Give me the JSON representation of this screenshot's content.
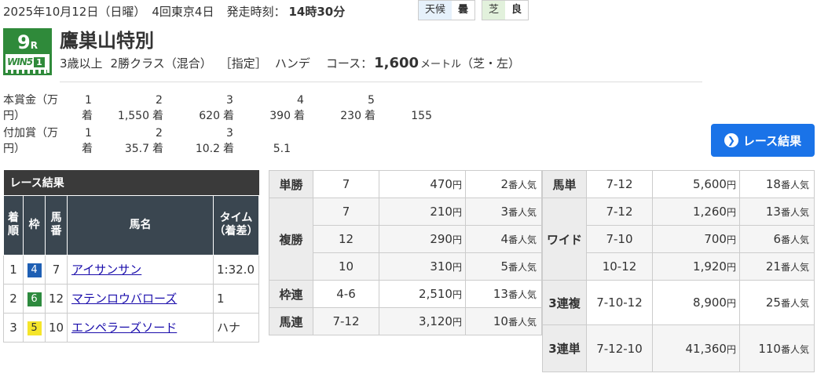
{
  "header": {
    "date": "2025年10月12日（日曜）",
    "meeting": "4回東京4日",
    "start_label": "発走時刻：",
    "start_time": "14時30分",
    "weather_label": "天候",
    "weather_value": "曇",
    "turf_label": "芝",
    "turf_value": "良"
  },
  "race": {
    "number": "9",
    "number_suffix": "R",
    "win5_text": "WIN5",
    "win5_leg": "1",
    "name": "鷹巣山特別",
    "age": "3歳以上",
    "class": "2勝クラス（混合）",
    "designation": "［指定］",
    "weight_rule": "ハンデ",
    "course_label": "コース：",
    "distance": "1,600",
    "distance_unit": "メートル",
    "surface": "（芝・左）"
  },
  "prize": {
    "main_label": "本賞金（万円）",
    "main": [
      {
        "place": "1",
        "suffix": "着",
        "amount": "1,550"
      },
      {
        "place": "2",
        "suffix": "着",
        "amount": "620"
      },
      {
        "place": "3",
        "suffix": "着",
        "amount": "390"
      },
      {
        "place": "4",
        "suffix": "着",
        "amount": "230"
      },
      {
        "place": "5",
        "suffix": "着",
        "amount": "155"
      }
    ],
    "extra_label": "付加賞（万円）",
    "extra": [
      {
        "place": "1",
        "suffix": "着",
        "amount": "35.7"
      },
      {
        "place": "2",
        "suffix": "着",
        "amount": "10.2"
      },
      {
        "place": "3",
        "suffix": "着",
        "amount": "5.1"
      }
    ]
  },
  "result_button": {
    "label": "レース結果"
  },
  "results": {
    "title": "レース結果",
    "headers": {
      "place": "着順",
      "waku": "枠",
      "num": "馬番",
      "name": "馬名",
      "time": "タイム（着差）"
    },
    "rows": [
      {
        "place": "1",
        "waku": "4",
        "waku_bg": "#1e5fb4",
        "waku_fg": "#ffffff",
        "num": "7",
        "name": "アイサンサン",
        "time": "1:32.0"
      },
      {
        "place": "2",
        "waku": "6",
        "waku_bg": "#2d8a3e",
        "waku_fg": "#ffffff",
        "num": "12",
        "name": "マテンロウバローズ",
        "time": "1"
      },
      {
        "place": "3",
        "waku": "5",
        "waku_bg": "#f5e52a",
        "waku_fg": "#333333",
        "num": "10",
        "name": "エンペラーズソード",
        "time": "ハナ"
      }
    ]
  },
  "payouts_left": {
    "yen": "円",
    "pop_suffix": "番人気",
    "tansho": {
      "label": "単勝",
      "rows": [
        {
          "combo": "7",
          "amount": "470",
          "pop": "2"
        }
      ]
    },
    "fukusho": {
      "label": "複勝",
      "rows": [
        {
          "combo": "7",
          "amount": "210",
          "pop": "3"
        },
        {
          "combo": "12",
          "amount": "290",
          "pop": "4"
        },
        {
          "combo": "10",
          "amount": "310",
          "pop": "5"
        }
      ]
    },
    "wakuren": {
      "label": "枠連",
      "rows": [
        {
          "combo": "4-6",
          "amount": "2,510",
          "pop": "13"
        }
      ]
    },
    "umaren": {
      "label": "馬連",
      "rows": [
        {
          "combo": "7-12",
          "amount": "3,120",
          "pop": "10"
        }
      ]
    }
  },
  "payouts_right": {
    "umatan": {
      "label": "馬単",
      "rows": [
        {
          "combo": "7-12",
          "amount": "5,600",
          "pop": "18"
        }
      ]
    },
    "wide": {
      "label": "ワイド",
      "rows": [
        {
          "combo": "7-12",
          "amount": "1,260",
          "pop": "13"
        },
        {
          "combo": "7-10",
          "amount": "700",
          "pop": "6"
        },
        {
          "combo": "10-12",
          "amount": "1,920",
          "pop": "21"
        }
      ]
    },
    "trio": {
      "label": "3連複",
      "rows": [
        {
          "combo": "7-10-12",
          "amount": "8,900",
          "pop": "25"
        }
      ]
    },
    "trifecta": {
      "label": "3連単",
      "rows": [
        {
          "combo": "7-12-10",
          "amount": "41,360",
          "pop": "110"
        }
      ]
    }
  }
}
